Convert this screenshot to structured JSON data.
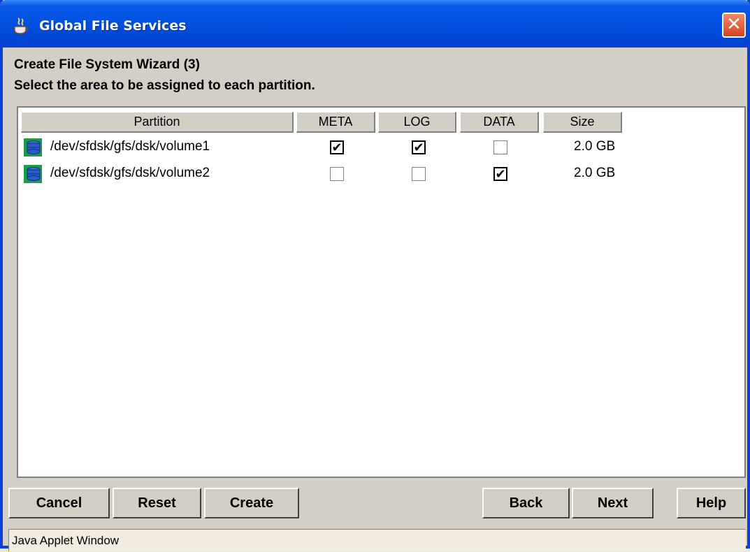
{
  "window": {
    "title": "Global File Services",
    "close_glyph": "✕",
    "icon": "java-coffee-icon"
  },
  "wizard": {
    "title": "Create File System Wizard (3)",
    "instruction": "Select the area to be assigned to each partition."
  },
  "table": {
    "columns": [
      "Partition",
      "META",
      "LOG",
      "DATA",
      "Size"
    ],
    "rows": [
      {
        "partition": "/dev/sfdsk/gfs/dsk/volume1",
        "meta": true,
        "log": true,
        "data": false,
        "size": "2.0 GB"
      },
      {
        "partition": "/dev/sfdsk/gfs/dsk/volume2",
        "meta": false,
        "log": false,
        "data": true,
        "size": "2.0 GB"
      }
    ],
    "row_icon": "disk-volume-icon"
  },
  "buttons": {
    "cancel": "Cancel",
    "reset": "Reset",
    "create": "Create",
    "back": "Back",
    "next": "Next",
    "help": "Help"
  },
  "status": {
    "text": "Java Applet Window"
  },
  "colors": {
    "titlebar": "#0054e3",
    "close": "#e04a25",
    "panel": "#d4d0c8",
    "row_icon": "#1a9c4a"
  }
}
